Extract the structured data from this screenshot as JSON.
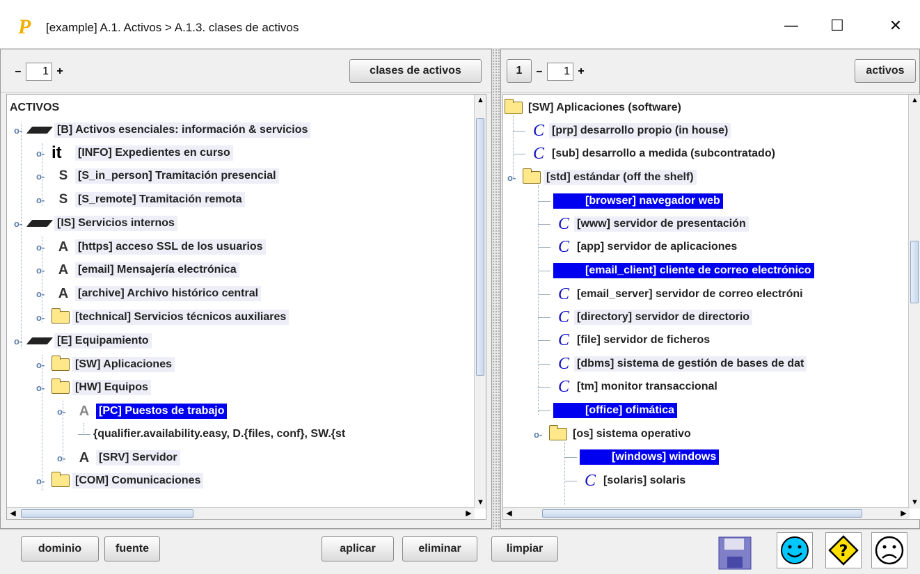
{
  "window": {
    "logo_letter": "P",
    "title": "[example] A.1. Activos > A.1.3. clases de activos",
    "minimize_glyph": "—",
    "maximize_glyph": "☐",
    "close_glyph": "✕"
  },
  "left": {
    "pager": {
      "minus": "–",
      "value": "1",
      "plus": "+"
    },
    "button": "clases de activos",
    "root": "ACTIVOS",
    "items": [
      {
        "label": "[B] Activos esenciales: información & servicios",
        "icon": "disk-icon"
      },
      {
        "label": "[INFO] Expedientes en curso",
        "icon": "it",
        "icon_text": "it"
      },
      {
        "label": "[S_in_person] Tramitación presencial",
        "icon": "s",
        "icon_text": "S"
      },
      {
        "label": "[S_remote] Tramitación remota",
        "icon": "s",
        "icon_text": "S"
      },
      {
        "label": "[IS] Servicios internos",
        "icon": "disk-icon"
      },
      {
        "label": "[https] acceso SSL de los usuarios",
        "icon": "a",
        "icon_text": "A"
      },
      {
        "label": "[email] Mensajería electrónica",
        "icon": "a",
        "icon_text": "A"
      },
      {
        "label": "[archive] Archivo histórico central",
        "icon": "a",
        "icon_text": "A"
      },
      {
        "label": "[technical] Servicios técnicos auxiliares",
        "icon": "folder-icon"
      },
      {
        "label": "[E] Equipamiento",
        "icon": "disk-icon"
      },
      {
        "label": "[SW] Aplicaciones",
        "icon": "folder-icon"
      },
      {
        "label": "[HW] Equipos",
        "icon": "folder-icon"
      },
      {
        "label": "[PC] Puestos de trabajo",
        "icon": "a",
        "icon_text": "A"
      },
      {
        "label": "{qualifier.availability.easy, D.{files, conf}, SW.{st",
        "icon": "none"
      },
      {
        "label": "[SRV] Servidor",
        "icon": "a",
        "icon_text": "A"
      },
      {
        "label": "[COM] Comunicaciones",
        "icon": "folder-icon"
      }
    ]
  },
  "right": {
    "level": "1",
    "pager": {
      "minus": "–",
      "value": "1",
      "plus": "+"
    },
    "button": "activos",
    "items": [
      {
        "label": "[SW] Aplicaciones (software)",
        "icon": "folder-icon"
      },
      {
        "label": "[prp] desarrollo propio (in house)",
        "icon_text": "C"
      },
      {
        "label": "[sub] desarrollo a medida (subcontratado)",
        "icon_text": "C"
      },
      {
        "label": "[std] estándar (off the shelf)",
        "icon": "folder-icon"
      },
      {
        "label": "[browser] navegador web"
      },
      {
        "label": "[www] servidor de presentación",
        "icon_text": "C"
      },
      {
        "label": "[app] servidor de aplicaciones",
        "icon_text": "C"
      },
      {
        "label": "[email_client] cliente de correo electrónico"
      },
      {
        "label": "[email_server] servidor de correo electróni",
        "icon_text": "C"
      },
      {
        "label": "[directory] servidor de directorio",
        "icon_text": "C"
      },
      {
        "label": "[file] servidor de ficheros",
        "icon_text": "C"
      },
      {
        "label": "[dbms] sistema de gestión de bases de dat",
        "icon_text": "C"
      },
      {
        "label": "[tm] monitor transaccional",
        "icon_text": "C"
      },
      {
        "label": "[office] ofimática"
      },
      {
        "label": "[os] sistema operativo",
        "icon": "folder-icon"
      },
      {
        "label": "[windows] windows"
      },
      {
        "label": "[solaris] solaris",
        "icon_text": "C"
      }
    ]
  },
  "bottom": {
    "dominio": "dominio",
    "fuente": "fuente",
    "aplicar": "aplicar",
    "eliminar": "eliminar",
    "limpiar": "limpiar"
  }
}
